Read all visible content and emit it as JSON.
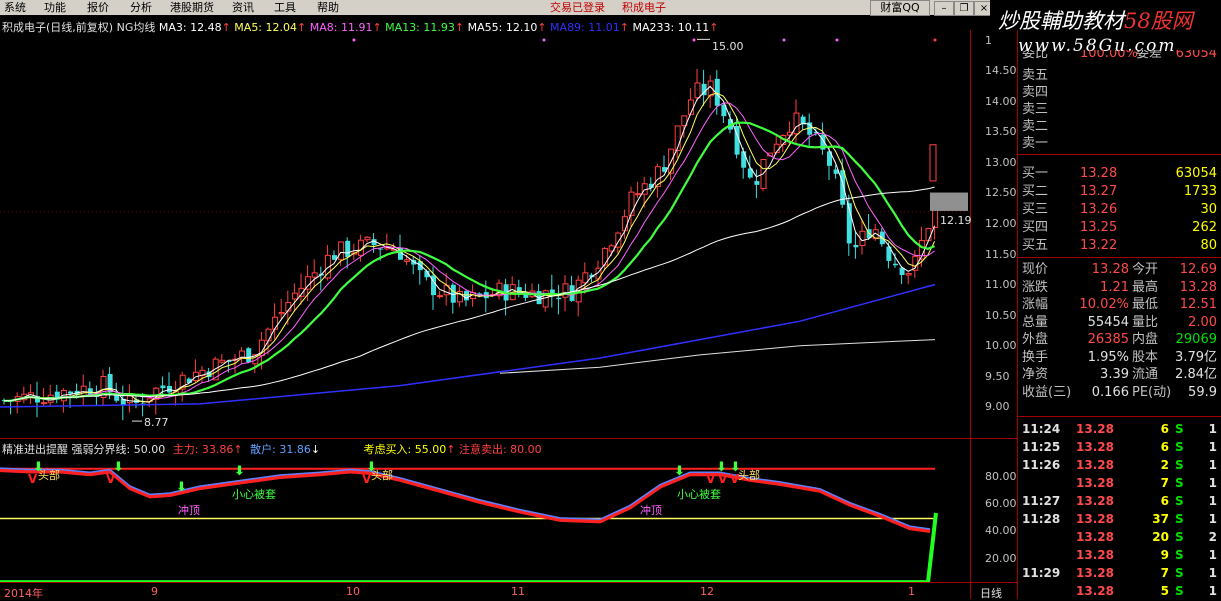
{
  "menu": {
    "items": [
      "系统",
      "功能",
      "报价",
      "分析",
      "港股期货",
      "资讯",
      "工具",
      "帮助"
    ],
    "status_login": "交易已登录",
    "status_stock": "积成电子",
    "caifu_btn": "财富QQ",
    "win_min": "–",
    "win_restore": "❐",
    "win_close": "×"
  },
  "watermark": {
    "text1": "炒股輔助教材",
    "text2_red": "58股网",
    "text3": "www.58Gu.com"
  },
  "main_chart": {
    "title": "积成电子(日线,前复权)",
    "indicator": "NG均线",
    "ma3": "MA3: 12.48",
    "ma5": "MA5: 12.04",
    "ma8": "MA8: 11.91",
    "ma13": "MA13: 11.93",
    "ma55": "MA55: 12.10",
    "ma89": "MA89: 11.01",
    "ma233": "MA233: 10.11",
    "price_ticks": [
      "14.50",
      "14.00",
      "13.50",
      "13.00",
      "12.50",
      "12.00",
      "11.50",
      "11.00",
      "10.50",
      "10.00",
      "9.50",
      "9.00"
    ],
    "high_mark": "15.00",
    "low_mark": "8.77",
    "current_mark": "12.19",
    "top_tick": "1"
  },
  "sub_chart": {
    "title": "精准进出提醒",
    "boundary": "强弱分界线: 50.00",
    "main_force": "主力: 33.86",
    "retail": "散户: 31.86",
    "consider_buy": "考虑买入: 55.00",
    "caution_sell": "注意卖出: 80.00",
    "ticks": [
      "80.00",
      "60.00",
      "40.00",
      "20.00"
    ],
    "annotations": [
      "头部",
      "头部",
      "头部",
      "冲顶",
      "冲顶",
      "小心被套",
      "小心被套"
    ]
  },
  "axis": {
    "dates": [
      "2014年",
      "9",
      "10",
      "11",
      "12",
      "1"
    ],
    "period": "日线"
  },
  "quote_panel": {
    "top_cut": [
      "委比",
      "100.00%",
      "委差",
      "63054"
    ],
    "sells": [
      {
        "label": "卖五"
      },
      {
        "label": "卖四"
      },
      {
        "label": "卖三"
      },
      {
        "label": "卖二"
      },
      {
        "label": "卖一"
      }
    ],
    "buys": [
      {
        "label": "买一",
        "price": "13.28",
        "vol": "63054"
      },
      {
        "label": "买二",
        "price": "13.27",
        "vol": "1733"
      },
      {
        "label": "买三",
        "price": "13.26",
        "vol": "30"
      },
      {
        "label": "买四",
        "price": "13.25",
        "vol": "262"
      },
      {
        "label": "买五",
        "price": "13.22",
        "vol": "80"
      }
    ],
    "stats": [
      {
        "l1": "现价",
        "v1": "13.28",
        "l2": "今开",
        "v2": "12.69"
      },
      {
        "l1": "涨跌",
        "v1": "1.21",
        "l2": "最高",
        "v2": "13.28"
      },
      {
        "l1": "涨幅",
        "v1": "10.02%",
        "l2": "最低",
        "v2": "12.51"
      },
      {
        "l1": "总量",
        "v1": "55454",
        "l2": "量比",
        "v2": "2.00"
      },
      {
        "l1": "外盘",
        "v1": "26385",
        "l2": "内盘",
        "v2": "29069"
      },
      {
        "l1": "换手",
        "v1": "1.95%",
        "l2": "股本",
        "v2": "3.79亿"
      },
      {
        "l1": "净资",
        "v1": "3.39",
        "l2": "流通",
        "v2": "2.84亿"
      },
      {
        "l1": "收益(三)",
        "v1": "0.166",
        "l2": "PE(动)",
        "v2": "59.9"
      }
    ],
    "trades": [
      {
        "time": "11:24",
        "price": "13.28",
        "vol": "6",
        "side": "S",
        "num": "1"
      },
      {
        "time": "11:25",
        "price": "13.28",
        "vol": "6",
        "side": "S",
        "num": "1"
      },
      {
        "time": "11:26",
        "price": "13.28",
        "vol": "2",
        "side": "S",
        "num": "1"
      },
      {
        "time": "",
        "price": "13.28",
        "vol": "7",
        "side": "S",
        "num": "1"
      },
      {
        "time": "11:27",
        "price": "13.28",
        "vol": "6",
        "side": "S",
        "num": "1"
      },
      {
        "time": "11:28",
        "price": "13.28",
        "vol": "37",
        "side": "S",
        "num": "1"
      },
      {
        "time": "",
        "price": "13.28",
        "vol": "20",
        "side": "S",
        "num": "2"
      },
      {
        "time": "",
        "price": "13.28",
        "vol": "9",
        "side": "S",
        "num": "1"
      },
      {
        "time": "11:29",
        "price": "13.28",
        "vol": "7",
        "side": "S",
        "num": "1"
      },
      {
        "time": "",
        "price": "13.28",
        "vol": "5",
        "side": "S",
        "num": "1"
      }
    ]
  },
  "colors": {
    "up": "#ff4040",
    "down": "#40e0e0",
    "ma3": "#ffffff",
    "ma5": "#ffff60",
    "ma8": "#ff60ff",
    "ma13": "#40ff40",
    "ma55": "#60c0ff",
    "ma89": "#3030ff",
    "ma233": "#ffffff"
  }
}
